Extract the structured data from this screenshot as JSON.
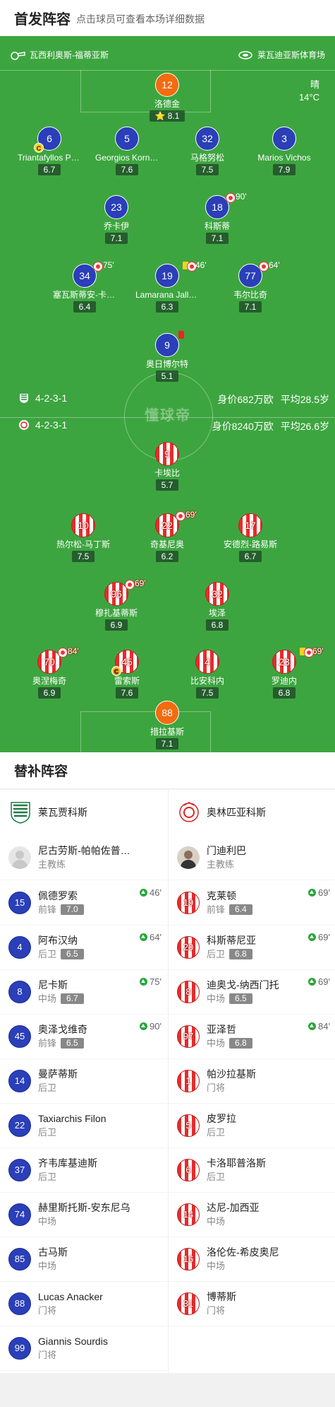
{
  "header": {
    "title": "首发阵容",
    "subtitle": "点击球员可查看本场详细数据"
  },
  "venue": {
    "referee": "瓦西利奥斯-福蒂亚斯",
    "stadium": "莱瓦迪亚斯体育场"
  },
  "weather": {
    "condition": "晴",
    "temp": "14°C"
  },
  "home_info": {
    "formation": "4-2-3-1",
    "value": "身价682万欧",
    "age": "平均28.5岁"
  },
  "away_info": {
    "formation": "4-2-3-1",
    "value": "身价8240万欧",
    "age": "平均26.6岁"
  },
  "watermark": "懂球帝",
  "home_players": [
    {
      "num": "12",
      "name": "洛德金",
      "rating": "8.1",
      "star": "⭐"
    },
    {
      "num": "6",
      "name": "Triantafyllos Pasalidis",
      "rating": "6.7",
      "cap": "C"
    },
    {
      "num": "5",
      "name": "Georgios Kornezos",
      "rating": "7.6"
    },
    {
      "num": "32",
      "name": "马格努松",
      "rating": "7.5"
    },
    {
      "num": "3",
      "name": "Marios Vichos",
      "rating": "7.9"
    },
    {
      "num": "23",
      "name": "乔卡伊",
      "rating": "7.1"
    },
    {
      "num": "18",
      "name": "科斯蒂",
      "rating": "7.1",
      "sub": "90'"
    },
    {
      "num": "34",
      "name": "塞瓦斯蒂安-卡卢吉斯",
      "rating": "6.4",
      "sub": "75'"
    },
    {
      "num": "19",
      "name": "Lamarana Jallow",
      "rating": "6.3",
      "sub": "46'"
    },
    {
      "num": "77",
      "name": "韦尔比奇",
      "rating": "7.1",
      "sub": "64'"
    },
    {
      "num": "9",
      "name": "奥日博尔特",
      "rating": "5.1"
    }
  ],
  "away_players": [
    {
      "num": "9",
      "name": "卡埃比",
      "rating": "5.7"
    },
    {
      "num": "10",
      "name": "热尔松-马丁斯",
      "rating": "7.5"
    },
    {
      "num": "22",
      "name": "奇基尼奥",
      "rating": "6.2",
      "sub": "69'"
    },
    {
      "num": "17",
      "name": "安德烈-路易斯",
      "rating": "6.7"
    },
    {
      "num": "96",
      "name": "穆扎基蒂斯",
      "rating": "6.9",
      "sub": "69'"
    },
    {
      "num": "32",
      "name": "埃泽",
      "rating": "6.8"
    },
    {
      "num": "70",
      "name": "奥涅梅奇",
      "rating": "6.9",
      "sub": "84'"
    },
    {
      "num": "45",
      "name": "雷索斯",
      "rating": "7.6",
      "cap": "C"
    },
    {
      "num": "4",
      "name": "比安科内",
      "rating": "7.5"
    },
    {
      "num": "23",
      "name": "罗迪内",
      "rating": "6.8",
      "sub": "69'"
    },
    {
      "num": "88",
      "name": "措拉基斯",
      "rating": "7.1"
    }
  ],
  "subs": {
    "title": "替补阵容",
    "home_team": "莱瓦贾科斯",
    "away_team": "奥林匹亚科斯",
    "home_coach": {
      "name": "尼古劳斯-帕帕佐普洛斯",
      "role": "主教练"
    },
    "away_coach": {
      "name": "门迪利巴",
      "role": "主教练"
    },
    "home": [
      {
        "num": "15",
        "name": "佩德罗索",
        "pos": "前锋",
        "rating": "7.0",
        "time": "46'"
      },
      {
        "num": "4",
        "name": "阿布汉纳",
        "pos": "后卫",
        "rating": "6.5",
        "time": "64'"
      },
      {
        "num": "8",
        "name": "尼卡斯",
        "pos": "中场",
        "rating": "6.7",
        "time": "75'"
      },
      {
        "num": "45",
        "name": "奥泽戈维奇",
        "pos": "前锋",
        "rating": "6.5",
        "time": "90'"
      },
      {
        "num": "14",
        "name": "曼萨蒂斯",
        "pos": "后卫"
      },
      {
        "num": "22",
        "name": "Taxiarchis Filon",
        "pos": "后卫"
      },
      {
        "num": "37",
        "name": "齐韦库基迪斯",
        "pos": "后卫"
      },
      {
        "num": "74",
        "name": "赫里斯托斯-安东尼乌",
        "pos": "中场"
      },
      {
        "num": "85",
        "name": "古马斯",
        "pos": "中场"
      },
      {
        "num": "88",
        "name": "Lucas Anacker",
        "pos": "门将"
      },
      {
        "num": "99",
        "name": "Giannis Sourdis",
        "pos": "门将"
      }
    ],
    "away": [
      {
        "num": "19",
        "name": "克莱顿",
        "pos": "前锋",
        "rating": "6.4",
        "time": "69'"
      },
      {
        "num": "20",
        "name": "科斯蒂尼亚",
        "pos": "后卫",
        "rating": "6.8",
        "time": "69'"
      },
      {
        "num": "8",
        "name": "迪奥戈-纳西门托",
        "pos": "中场",
        "rating": "6.5",
        "time": "69'"
      },
      {
        "num": "97",
        "name": "亚泽哲",
        "pos": "中场",
        "rating": "6.8",
        "time": "84'"
      },
      {
        "num": "1",
        "name": "帕沙拉基斯",
        "pos": "门将"
      },
      {
        "num": "5",
        "name": "皮罗拉",
        "pos": "后卫"
      },
      {
        "num": "6",
        "name": "卡洛耶普洛斯",
        "pos": "后卫"
      },
      {
        "num": "14",
        "name": "达尼-加西亚",
        "pos": "中场"
      },
      {
        "num": "16",
        "name": "洛伦佐-希皮奥尼",
        "pos": "中场"
      },
      {
        "num": "31",
        "name": "博蒂斯",
        "pos": "门将"
      }
    ]
  },
  "colors": {
    "pitch": "#3da53f",
    "home_jersey": "#2a3fb8",
    "gk_jersey": "#f26b0f",
    "away_stripe": "#e62c2c"
  }
}
